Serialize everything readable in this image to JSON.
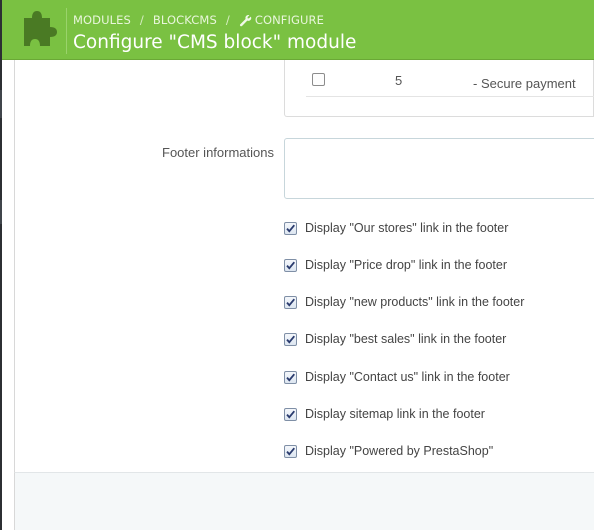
{
  "header": {
    "breadcrumb": {
      "modules": "MODULES",
      "module_name": "BLOCKCMS",
      "configure": "CONFIGURE"
    },
    "title": "Configure \"CMS block\" module",
    "accent_color": "#7ac142"
  },
  "cms_table": {
    "row": {
      "position": "5",
      "title": "- Secure payment",
      "checked": false
    }
  },
  "footer_info": {
    "label": "Footer informations",
    "value": ""
  },
  "options": [
    {
      "label": "Display \"Our stores\" link in the footer",
      "checked": true
    },
    {
      "label": "Display \"Price drop\" link in the footer",
      "checked": true
    },
    {
      "label": "Display \"new products\" link in the footer",
      "checked": true
    },
    {
      "label": "Display \"best sales\" link in the footer",
      "checked": true
    },
    {
      "label": "Display \"Contact us\" link in the footer",
      "checked": true
    },
    {
      "label": "Display sitemap link in the footer",
      "checked": true
    },
    {
      "label": "Display \"Powered by PrestaShop\"",
      "checked": true
    }
  ],
  "icons": {
    "module": "puzzle-piece-icon",
    "configure": "wrench-icon",
    "checkbox_checked": "checkmark-icon"
  }
}
